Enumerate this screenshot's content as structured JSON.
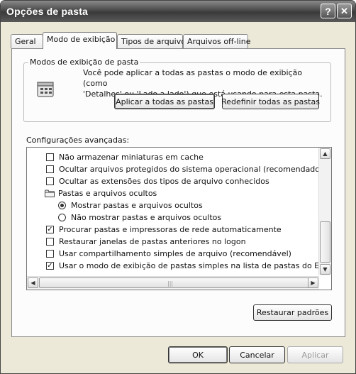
{
  "window": {
    "title": "Opções de pasta",
    "help_label": "?",
    "close_label": "✕"
  },
  "tabs": [
    {
      "label": "Geral",
      "active": false
    },
    {
      "label": "Modo de exibição",
      "active": true
    },
    {
      "label": "Tipos de arquivo",
      "active": false
    },
    {
      "label": "Arquivos off-line",
      "active": false
    }
  ],
  "folder_views": {
    "legend": "Modos de exibição de pasta",
    "icon": "folder-views-icon",
    "description_line1": "Você pode aplicar a todas as pastas o modo de exibição (como",
    "description_line2": "'Detalhes' ou 'Lado a lado') que está usando para esta pasta.",
    "apply_all_label": "Aplicar a todas as pastas",
    "reset_all_label": "Redefinir todas as pastas"
  },
  "advanced": {
    "label": "Configurações avançadas:",
    "items": [
      {
        "type": "checkbox",
        "checked": false,
        "indent": 1,
        "label": "Não armazenar miniaturas em cache"
      },
      {
        "type": "checkbox",
        "checked": false,
        "indent": 1,
        "label": "Ocultar arquivos protegidos do sistema operacional (recomendado)"
      },
      {
        "type": "checkbox",
        "checked": false,
        "indent": 1,
        "label": "Ocultar as extensões dos tipos de arquivo conhecidos"
      },
      {
        "type": "folder",
        "checked": false,
        "indent": 1,
        "label": "Pastas e arquivos ocultos"
      },
      {
        "type": "radio",
        "checked": true,
        "indent": 2,
        "label": "Mostrar pastas e arquivos ocultos"
      },
      {
        "type": "radio",
        "checked": false,
        "indent": 2,
        "label": "Não mostrar pastas e arquivos ocultos"
      },
      {
        "type": "checkbox",
        "checked": true,
        "indent": 1,
        "label": "Procurar pastas e impressoras de rede automaticamente"
      },
      {
        "type": "checkbox",
        "checked": false,
        "indent": 1,
        "label": "Restaurar janelas de pastas anteriores no logon"
      },
      {
        "type": "checkbox",
        "checked": false,
        "indent": 1,
        "label": "Usar compartilhamento simples de arquivo (recomendável)"
      },
      {
        "type": "checkbox",
        "checked": true,
        "indent": 1,
        "label": "Usar o modo de exibição de pastas simples na lista de pastas do Explorer"
      }
    ],
    "scroll_up": "▲",
    "scroll_down": "▼",
    "scroll_left": "◀",
    "scroll_right": "▶",
    "grip": "|||"
  },
  "restore_defaults_label": "Restaurar padrões",
  "footer": {
    "ok_label": "OK",
    "cancel_label": "Cancelar",
    "apply_label": "Aplicar"
  }
}
